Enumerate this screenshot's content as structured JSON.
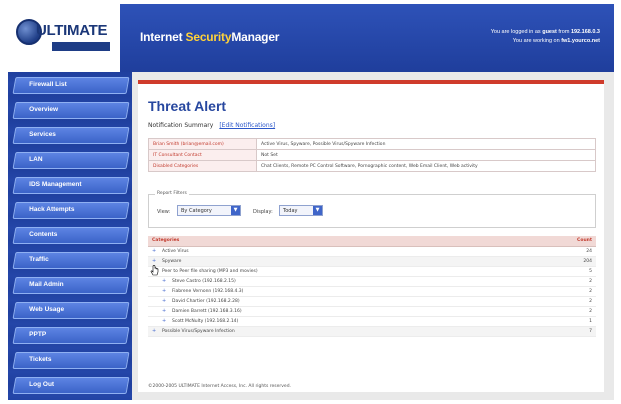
{
  "logo": {
    "text": "ULTIMATE"
  },
  "header": {
    "title_prefix": "Internet ",
    "title_accent": "Security",
    "title_suffix": "Manager",
    "login_line1_prefix": "You are logged in as ",
    "login_user": "guest",
    "login_line1_mid": " from ",
    "login_ip": "192.168.0.3",
    "login_line2_prefix": "You are working on ",
    "login_host": "fw1.yourco.net"
  },
  "sidebar": {
    "items": [
      {
        "label": "Firewall List"
      },
      {
        "label": "Overview"
      },
      {
        "label": "Services"
      },
      {
        "label": "LAN"
      },
      {
        "label": "IDS Management"
      },
      {
        "label": "Hack Attempts"
      },
      {
        "label": "Contents"
      },
      {
        "label": "Traffic"
      },
      {
        "label": "Mail Admin"
      },
      {
        "label": "Web Usage"
      },
      {
        "label": "PPTP"
      },
      {
        "label": "Tickets"
      },
      {
        "label": "Log Out"
      }
    ]
  },
  "panel": {
    "title": "Threat Alert",
    "summary_label": "Notification Summary",
    "summary_link": "[Edit Notifications]"
  },
  "info_rows": [
    {
      "key": "Brian Smith (brian@email.com)",
      "value": "Active Virus, Spyware, Possible Virus/Spyware Infection"
    },
    {
      "key": "IT Consultant Contact",
      "value": "Not Set"
    },
    {
      "key": "Disabled Categories",
      "value": "Chat Clients, Remote PC Control Software, Pornographic content, Web Email Client, Web activity"
    }
  ],
  "filters": {
    "legend": "Report Filters",
    "view_label": "View:",
    "view_value": "By Category",
    "display_label": "Display:",
    "display_value": "Today"
  },
  "categories": {
    "header_name": "Categories",
    "header_count": "Count",
    "rows": [
      {
        "name": "Active Virus",
        "count": "24",
        "level": 0,
        "toggle": "+"
      },
      {
        "name": "Spyware",
        "count": "204",
        "level": 0,
        "toggle": "+"
      },
      {
        "name": "Peer to Peer file sharing (MP3 and movies)",
        "count": "5",
        "level": 0,
        "toggle": "−"
      },
      {
        "name": "Steve Castro (192.168.2.15)",
        "count": "2",
        "level": 1,
        "toggle": "+"
      },
      {
        "name": "Fiabrene Vernonn (192.168.4.3)",
        "count": "2",
        "level": 1,
        "toggle": "+"
      },
      {
        "name": "David Chartier (192.168.2.28)",
        "count": "2",
        "level": 1,
        "toggle": "+"
      },
      {
        "name": "Damien Barrett (192.168.3.16)",
        "count": "2",
        "level": 1,
        "toggle": "+"
      },
      {
        "name": "Scott McNulty (192.168.2.14)",
        "count": "1",
        "level": 1,
        "toggle": "+"
      },
      {
        "name": "Possible Virus/Spyware Infection",
        "count": "7",
        "level": 0,
        "toggle": "+"
      }
    ]
  },
  "footer": {
    "text": "©2000-2005 ULTIMATE Internet Access, Inc. All rights reserved."
  },
  "colors": {
    "header": "#2e52b8",
    "accent": "#cf3b2b",
    "title": "#27479f"
  }
}
